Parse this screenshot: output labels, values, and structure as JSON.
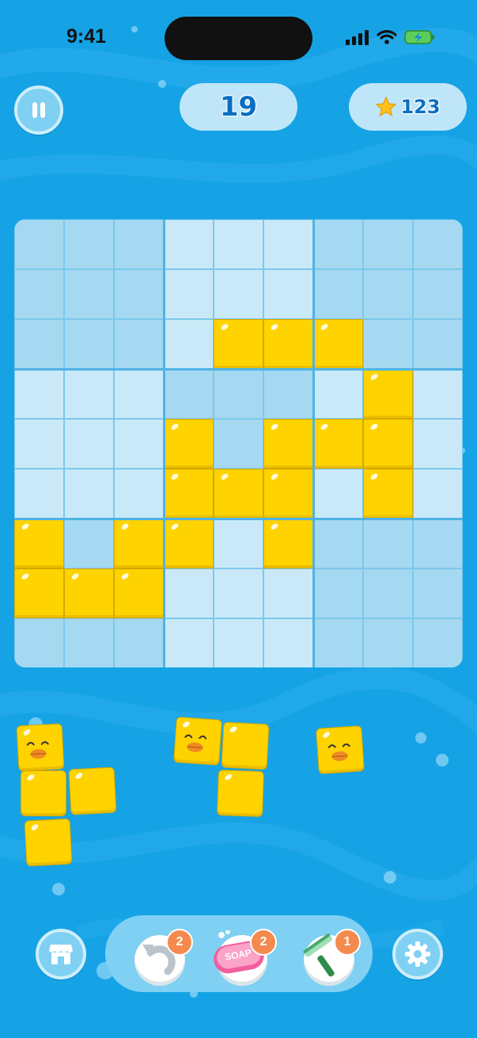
{
  "status": {
    "time": "9:41"
  },
  "header": {
    "level": "19",
    "stars": "123",
    "pause_icon": "pause-icon",
    "star_icon": "star-icon"
  },
  "board": {
    "size": 9,
    "filled_cells": [
      [
        2,
        4
      ],
      [
        2,
        5
      ],
      [
        2,
        6
      ],
      [
        3,
        7
      ],
      [
        4,
        3
      ],
      [
        4,
        5
      ],
      [
        4,
        6
      ],
      [
        4,
        7
      ],
      [
        5,
        3
      ],
      [
        5,
        4
      ],
      [
        5,
        5
      ],
      [
        5,
        7
      ],
      [
        6,
        0
      ],
      [
        6,
        2
      ],
      [
        6,
        3
      ],
      [
        6,
        5
      ],
      [
        7,
        0
      ],
      [
        7,
        1
      ],
      [
        7,
        2
      ]
    ]
  },
  "pieces": [
    {
      "name": "piece-1",
      "cells": 4
    },
    {
      "name": "piece-2",
      "cells": 3
    },
    {
      "name": "piece-3",
      "cells": 1
    }
  ],
  "bottom": {
    "shop_icon": "shop-icon",
    "settings_icon": "gear-icon",
    "boosters": [
      {
        "name": "undo-booster",
        "icon": "undo-icon",
        "count": "2"
      },
      {
        "name": "soap-booster",
        "icon": "soap-icon",
        "count": "2",
        "label": "SOAP"
      },
      {
        "name": "squeegee-booster",
        "icon": "squeegee-icon",
        "count": "1"
      }
    ]
  },
  "colors": {
    "background": "#16a3e6",
    "block": "#fed300",
    "badge": "#f48a4d"
  }
}
